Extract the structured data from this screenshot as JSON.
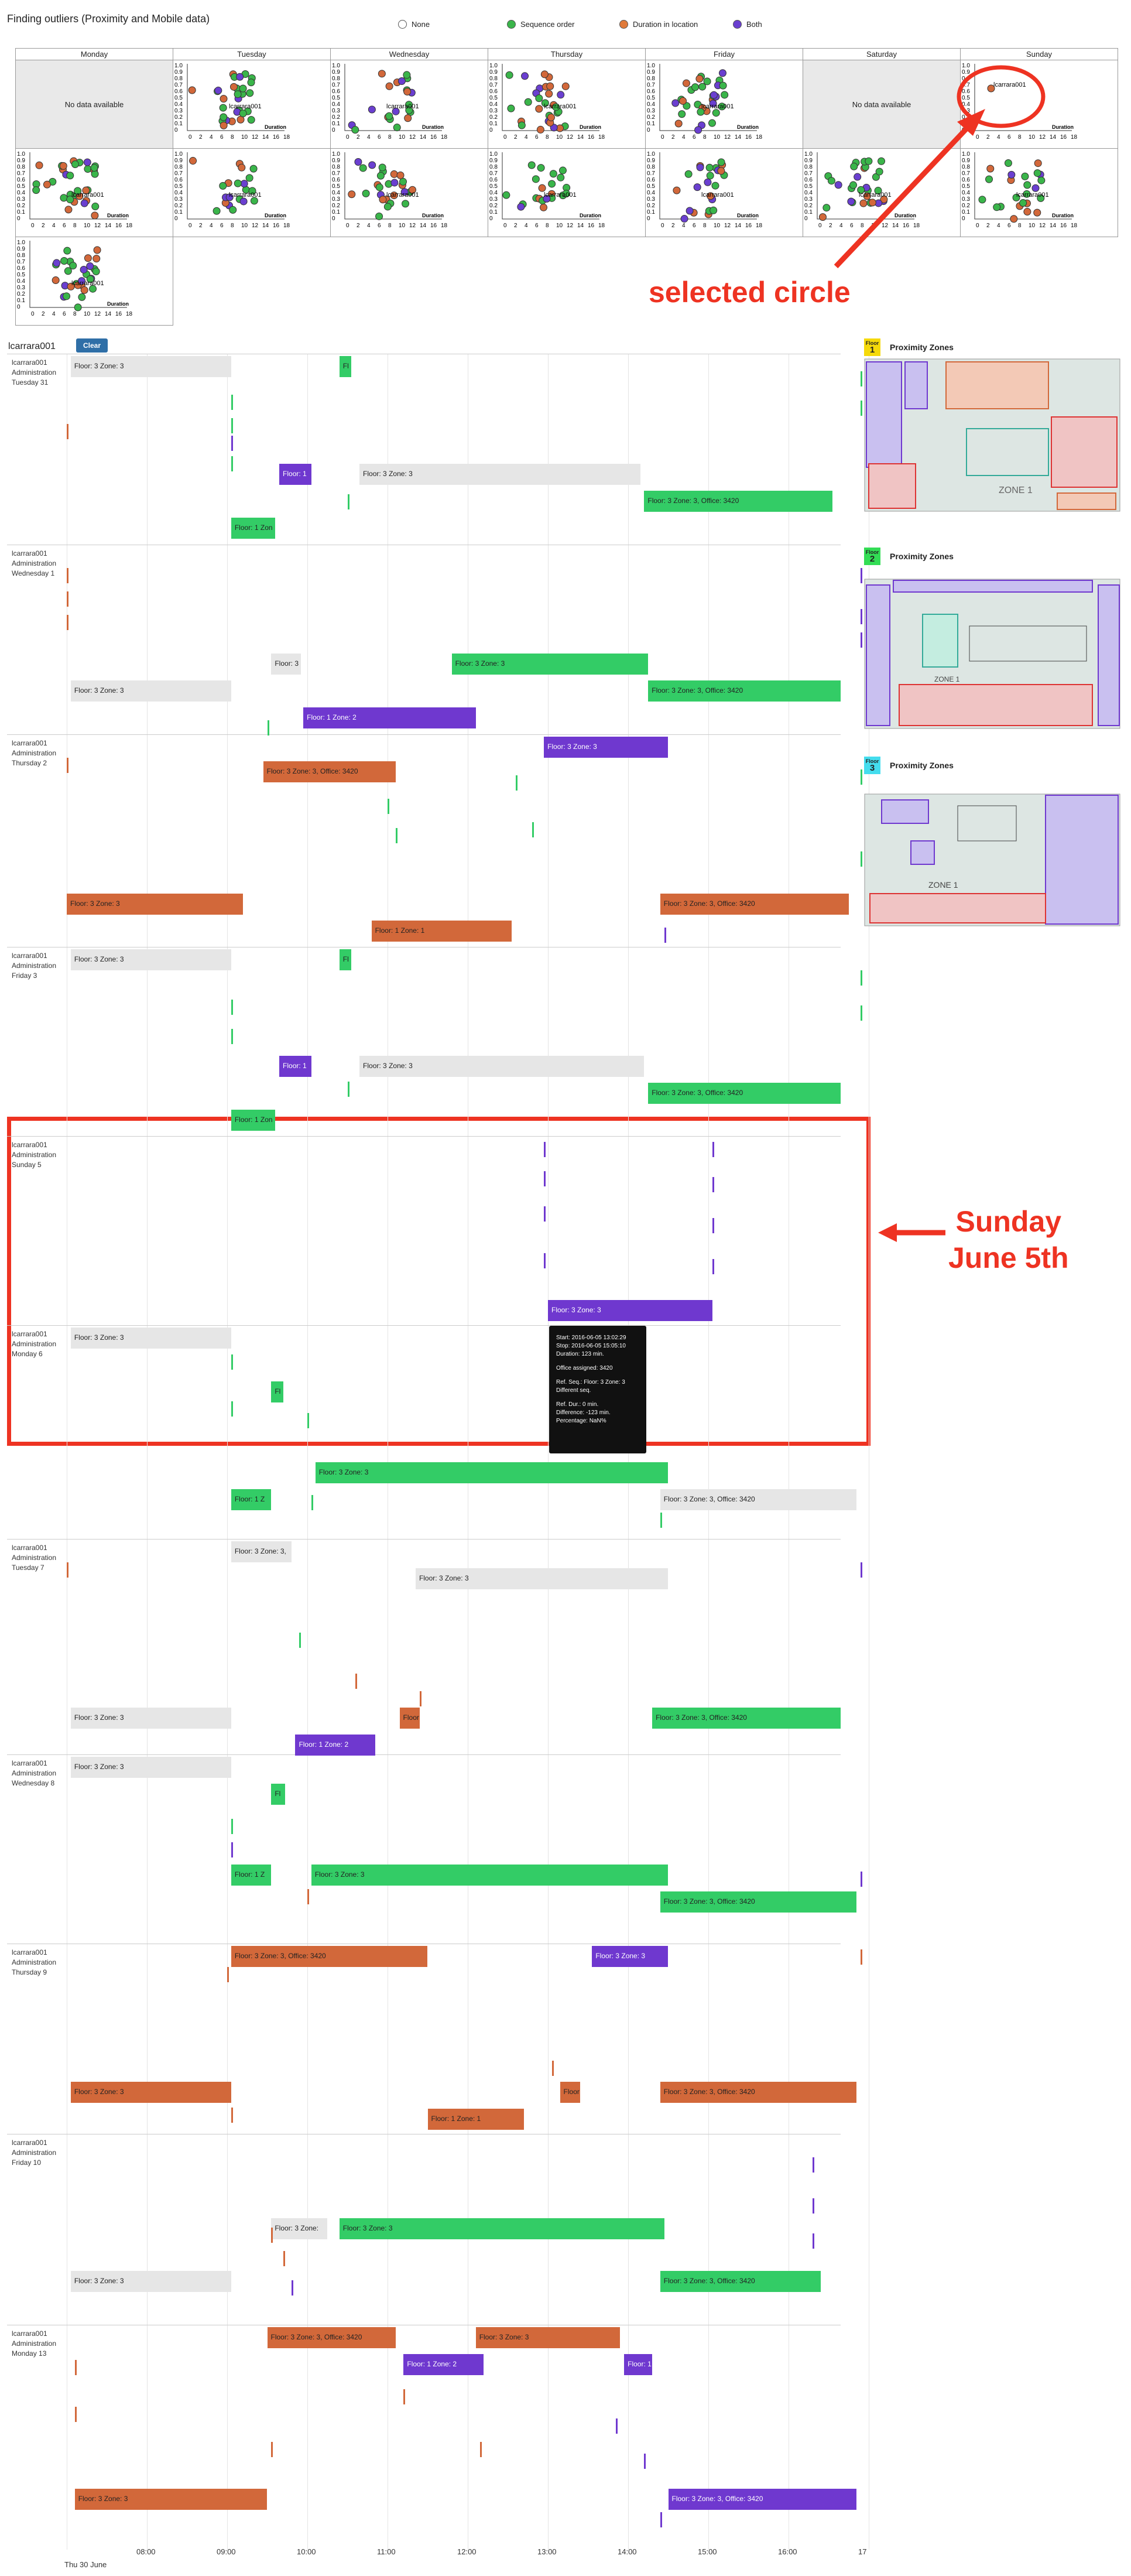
{
  "page": {
    "title": "Finding outliers (Proximity and Mobile data)"
  },
  "legend": [
    {
      "label": "None",
      "color": "#ffffff"
    },
    {
      "label": "Sequence order",
      "color": "#3ab54a"
    },
    {
      "label": "Duration in location",
      "color": "#e07a3a"
    },
    {
      "label": "Both",
      "color": "#6a3fd0"
    }
  ],
  "calendar": {
    "days": [
      "Monday",
      "Tuesday",
      "Wednesday",
      "Thursday",
      "Friday",
      "Saturday",
      "Sunday"
    ],
    "no_data": "No data available",
    "point_label": "lcarrara001",
    "axis_label": "Duration",
    "y_ticks": [
      "1.0",
      "0.9",
      "0.8",
      "0.7",
      "0.6",
      "0.5",
      "0.4",
      "0.3",
      "0.2",
      "0.1",
      "0"
    ],
    "x_ticks": [
      "0",
      "2",
      "4",
      "6",
      "8",
      "10",
      "12",
      "14",
      "16",
      "18"
    ]
  },
  "annotations": {
    "selected_circle": "selected circle",
    "sunday": "Sunday\nJune 5th"
  },
  "person": {
    "id": "lcarrara001",
    "clear": "Clear"
  },
  "timeline": {
    "rows": [
      {
        "label": [
          "lcarrara001",
          "Administration",
          "Tuesday 31"
        ]
      },
      {
        "label": [
          "lcarrara001",
          "Administration",
          "Wednesday 1"
        ]
      },
      {
        "label": [
          "lcarrara001",
          "Administration",
          "Thursday 2"
        ]
      },
      {
        "label": [
          "lcarrara001",
          "Administration",
          "Friday 3"
        ]
      },
      {
        "label": [
          "lcarrara001",
          "Administration",
          "Sunday 5"
        ]
      },
      {
        "label": [
          "lcarrara001",
          "Administration",
          "Monday 6"
        ]
      },
      {
        "label": [
          "lcarrara001",
          "Administration",
          "Tuesday 7"
        ]
      },
      {
        "label": [
          "lcarrara001",
          "Administration",
          "Wednesday 8"
        ]
      },
      {
        "label": [
          "lcarrara001",
          "Administration",
          "Thursday 9"
        ]
      },
      {
        "label": [
          "lcarrara001",
          "Administration",
          "Friday 10"
        ]
      },
      {
        "label": [
          "lcarrara001",
          "Administration",
          "Monday 13"
        ]
      }
    ],
    "bar_labels": {
      "f3z3": "Floor: 3 Zone: 3",
      "f3z3o": "Floor: 3 Zone: 3, Office: 3420",
      "f1z1": "Floor: 1 Zone: 1",
      "f1z": "Floor: 1 Zon",
      "f1": "Floor: 1",
      "f3": "Floor: 3",
      "f3z": "Floor: 3 Zone: 3,",
      "f3zone": "Floor: 3 Zone:",
      "f1z2": "Floor: 1 Zone: 2",
      "f1zone2": "Floor: 1 Zone: 2",
      "flo": "Fl",
      "floor": "Floor",
      "f1zn": "Floor: 1 Z",
      "fz": "Floor: 1 Zon"
    },
    "axis_ticks": [
      "08:00",
      "09:00",
      "10:00",
      "11:00",
      "12:00",
      "13:00",
      "14:00",
      "15:00",
      "16:00",
      "17"
    ],
    "axis_date": "Thu 30 June"
  },
  "tooltip": {
    "lines": [
      "Start: 2016-06-05 13:02:29",
      "Stop: 2016-06-05 15:05:10",
      "Duration: 123 min.",
      "Office assigned: 3420",
      "Ref. Seq.: Floor: 3 Zone: 3",
      "Different seq.",
      "Ref. Dur.: 0 min.",
      "Difference: -123 min.",
      "Percentage: NaN%"
    ]
  },
  "zones": [
    {
      "floor": "Floor",
      "num": "1",
      "title": "Proximity Zones",
      "badge": "#f5d90a"
    },
    {
      "floor": "Floor",
      "num": "2",
      "title": "Proximity Zones",
      "badge": "#33dd55"
    },
    {
      "floor": "Floor",
      "num": "3",
      "title": "Proximity Zones",
      "badge": "#44ddee"
    }
  ]
}
